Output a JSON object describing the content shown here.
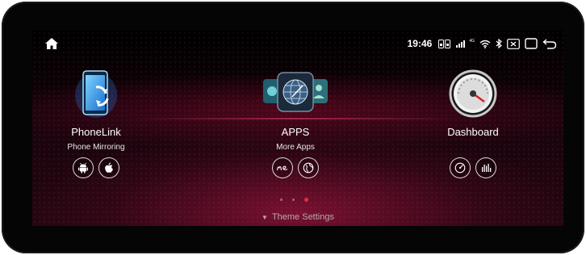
{
  "status": {
    "time": "19:46",
    "network_label": "4G"
  },
  "apps": [
    {
      "title": "PhoneLink",
      "subtitle": "Phone Mirroring",
      "buttons": [
        "android-icon",
        "apple-icon"
      ]
    },
    {
      "title": "APPS",
      "subtitle": "More Apps",
      "buttons": [
        "me-icon",
        "globe-icon"
      ]
    },
    {
      "title": "Dashboard",
      "subtitle": "",
      "buttons": [
        "gauge-icon",
        "equalizer-icon"
      ]
    }
  ],
  "pager": {
    "count": 3,
    "active_index": 2
  },
  "theme": {
    "label": "Theme Settings",
    "arrow": "▼"
  },
  "colors": {
    "accent_red": "#e0303a",
    "glow": "#a0143c"
  }
}
